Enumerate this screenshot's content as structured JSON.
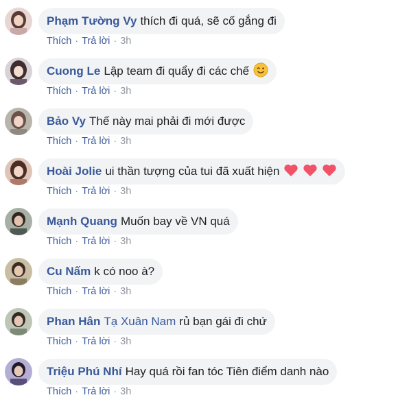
{
  "comments": [
    {
      "author": "Phạm Tường Vy",
      "text": "thích đi quá, sẽ cố gắng đi",
      "avatar_color": "#c9a8a8"
    },
    {
      "author": "Cuong Le",
      "text": "Lập team đi quẩy đi các chế",
      "emoji": "wink-smile-emoji",
      "avatar_color": "#6b5a6a"
    },
    {
      "author": "Bảo Vy",
      "text": "Thế này mai phải đi mới được",
      "avatar_color": "#8e8a82"
    },
    {
      "author": "Hoài Jolie",
      "text": "ui thần tượng của tui đã xuất hiện",
      "hearts": 3,
      "heart_color": "#f25268",
      "avatar_color": "#b07a6a"
    },
    {
      "author": "Mạnh Quang",
      "text": "Muốn bay về VN quá",
      "avatar_color": "#4f5a52"
    },
    {
      "author": "Cu Nấm",
      "text": "k có noo à?",
      "avatar_color": "#8a7d62"
    },
    {
      "author": "Phan Hân",
      "mention": "Tạ Xuân Nam",
      "text": "rủ bạn gái đi chứ",
      "avatar_color": "#7e8a78"
    },
    {
      "author": "Triệu Phú Nhí",
      "text": "Hay quá rồi fan tóc Tiên điểm danh nào",
      "avatar_color": "#5a4f7a"
    }
  ],
  "actions": {
    "like": "Thích",
    "reply": "Trả lời",
    "separator": "·",
    "time": "3h"
  },
  "colors": {
    "link": "#385898",
    "bubble": "#f2f3f5",
    "meta": "#90949c"
  }
}
